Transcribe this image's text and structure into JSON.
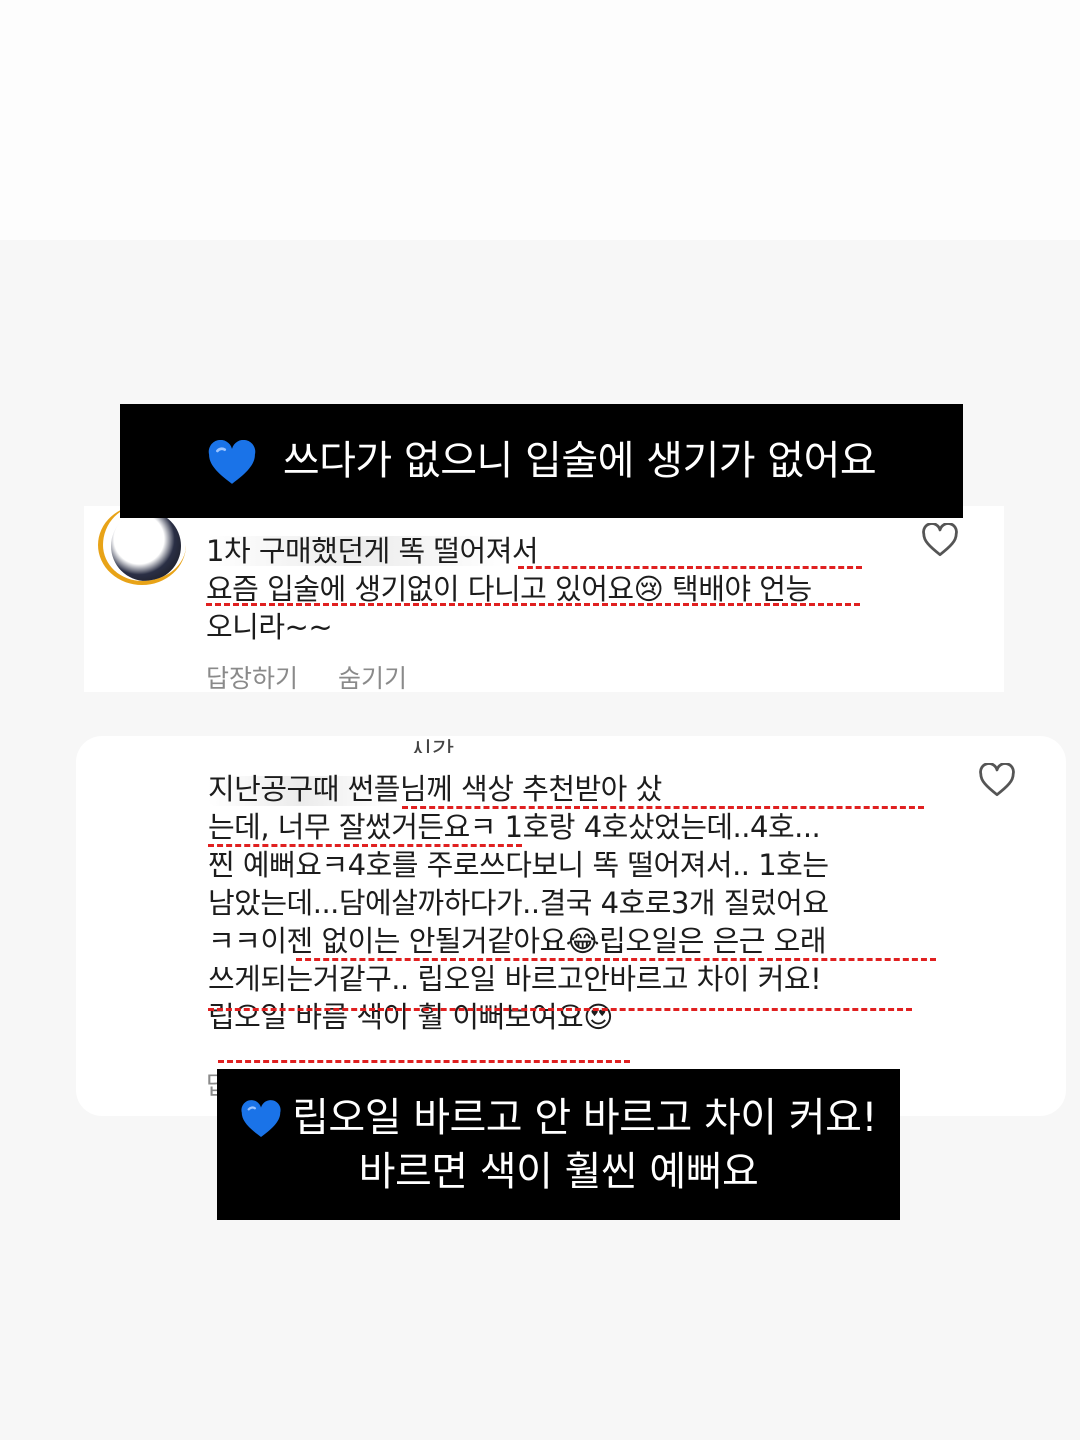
{
  "banner_top": {
    "icon": "blue-heart-icon",
    "text": "쓰다가 없으니 입술에 생기가 없어요"
  },
  "comment1": {
    "text": "1차 구매했던게 똑 떨어져서\n요즘 입술에 생기없이 다니고 있어요😢  택배야 언능\n오니라~~",
    "reply_label": "답장하기",
    "hide_label": "숨기기",
    "icon": "heart-outline-icon"
  },
  "comment2": {
    "time": "시간",
    "text": "지난공구때 썬플님께 색상 추천받아 샀\n는데,  너무 잘썼거든요ㅋ 1호랑 4호샀었는데..4호...\n찐 예뻐요ㅋ4호를 주로쓰다보니 똑 떨어져서.. 1호는\n남았는데...담에살까하다가..결국 4호로3개 질렀어요\nㅋㅋ이젠 없이는 안될거같아요😂립오일은 은근 오래\n쓰게되는거같구.. 립오일 바르고안바르고 차이 커요!\n립오일 바름 색이 훨 이뻐보여요😍",
    "reply_label": "답",
    "icon": "heart-outline-icon"
  },
  "banner_bottom": {
    "icon": "blue-heart-icon",
    "line1": "립오일 바르고 안 바르고 차이 커요!",
    "line2": "바르면 색이 훨씬 예뻐요"
  },
  "colors": {
    "banner_bg": "#000000",
    "underline": "#e02020",
    "heart_blue": "#1a73e8",
    "avatar_ring": "#e8a317"
  }
}
